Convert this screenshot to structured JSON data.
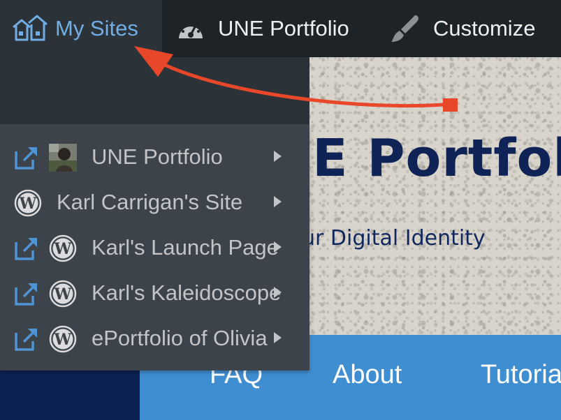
{
  "admin_bar": {
    "my_sites_label": "My Sites",
    "site_label": "UNE Portfolio",
    "customize_label": "Customize"
  },
  "dropdown": {
    "sites": [
      {
        "name": "UNE Portfolio",
        "external_link": true,
        "icon": "avatar-thumbnail",
        "has_submenu": true
      },
      {
        "name": "Karl Carrigan's Site",
        "external_link": false,
        "icon": "wordpress-icon",
        "has_submenu": true
      },
      {
        "name": "Karl's Launch Page",
        "external_link": true,
        "icon": "wordpress-icon",
        "has_submenu": true
      },
      {
        "name": "Karl's Kaleidoscope",
        "external_link": true,
        "icon": "wordpress-icon",
        "has_submenu": true
      },
      {
        "name": "ePortfolio of Olivia",
        "external_link": true,
        "icon": "wordpress-icon",
        "has_submenu": true
      }
    ]
  },
  "site": {
    "title": "E Portfolio",
    "tagline": "ur Digital Identity",
    "nav": [
      "FAQ",
      "About",
      "Tutorials"
    ]
  },
  "colors": {
    "admin_bar_bg": "#1d2327",
    "my_sites_bg": "#2c3338",
    "dropdown_bg": "#3c434a",
    "admin_link": "#72aee6",
    "admin_text": "#f0f0f1",
    "menu_text": "#c3c4c7",
    "site_title": "#0f2356",
    "nav_bg": "#3f8ed1",
    "annotation_arrow": "#e8472a"
  }
}
